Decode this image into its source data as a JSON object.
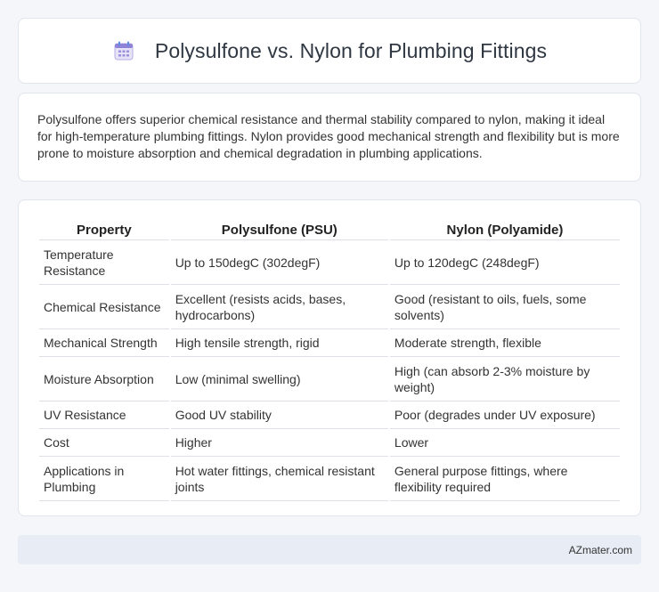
{
  "header": {
    "title": "Polysulfone vs. Nylon for Plumbing Fittings",
    "icon": "calendar-icon"
  },
  "intro": {
    "text": "Polysulfone offers superior chemical resistance and thermal stability compared to nylon, making it ideal for high-temperature plumbing fittings. Nylon provides good mechanical strength and flexibility but is more prone to moisture absorption and chemical degradation in plumbing applications."
  },
  "table": {
    "headers": [
      "Property",
      "Polysulfone (PSU)",
      "Nylon (Polyamide)"
    ],
    "rows": [
      [
        "Temperature Resistance",
        "Up to 150degC (302degF)",
        "Up to 120degC (248degF)"
      ],
      [
        "Chemical Resistance",
        "Excellent (resists acids, bases, hydrocarbons)",
        "Good (resistant to oils, fuels, some solvents)"
      ],
      [
        "Mechanical Strength",
        "High tensile strength, rigid",
        "Moderate strength, flexible"
      ],
      [
        "Moisture Absorption",
        "Low (minimal swelling)",
        "High (can absorb 2-3% moisture by weight)"
      ],
      [
        "UV Resistance",
        "Good UV stability",
        "Poor (degrades under UV exposure)"
      ],
      [
        "Cost",
        "Higher",
        "Lower"
      ],
      [
        "Applications in Plumbing",
        "Hot water fittings, chemical resistant joints",
        "General purpose fittings, where flexibility required"
      ]
    ]
  },
  "footer": {
    "text": "AZmater.com"
  }
}
